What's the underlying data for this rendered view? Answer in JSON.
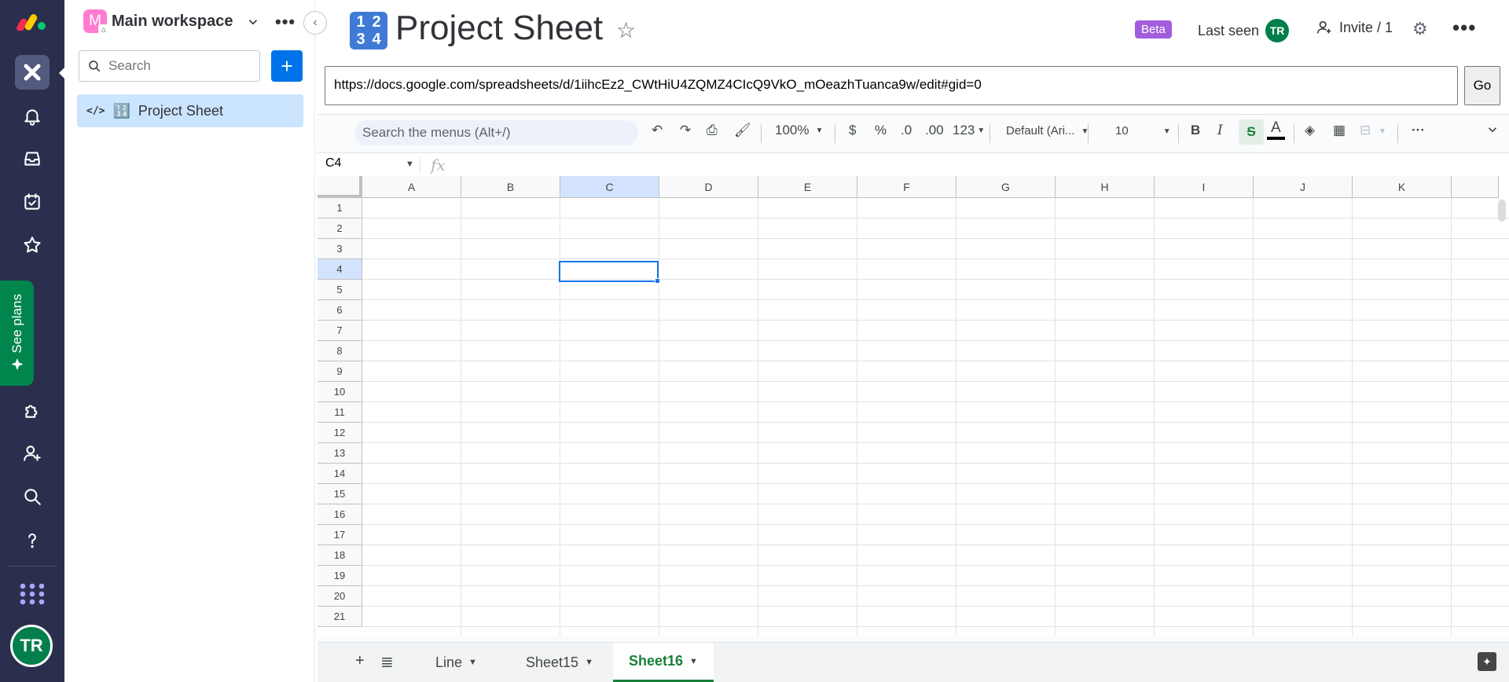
{
  "rail": {
    "see_plans": "See plans",
    "user_initials": "TR"
  },
  "workspace": {
    "avatar_letter": "M",
    "name": "Main workspace",
    "search_placeholder": "Search",
    "add_label": "+",
    "board_emoji": "🔢",
    "board_label": "Project Sheet"
  },
  "header": {
    "title_emoji": [
      "1",
      "2",
      "3",
      "4"
    ],
    "title": "Project Sheet",
    "beta": "Beta",
    "last_seen": "Last seen",
    "last_seen_initials": "TR",
    "invite": "Invite / 1"
  },
  "embed": {
    "url": "https://docs.google.com/spreadsheets/d/1iihcEz2_CWtHiU4ZQMZ4CIcQ9VkO_mOeazhTuanca9w/edit#gid=0",
    "go": "Go"
  },
  "sheet": {
    "search_menus": "Search the menus (Alt+/)",
    "zoom": "100%",
    "currency": "$",
    "percent": "%",
    "dec_decrease": ".0",
    "dec_increase": ".00",
    "number_format": "123",
    "font": "Default (Ari...",
    "font_size": "10",
    "bold": "B",
    "italic": "I",
    "strike": "S",
    "text_color_letter": "A",
    "name_box": "C4",
    "fx": "fx",
    "columns": [
      "A",
      "B",
      "C",
      "D",
      "E",
      "F",
      "G",
      "H",
      "I",
      "J",
      "K"
    ],
    "selected_column": "C",
    "selected_row": "4",
    "rows": [
      "1",
      "2",
      "3",
      "4",
      "5",
      "6",
      "7",
      "8",
      "9",
      "10",
      "11",
      "12",
      "13",
      "14",
      "15",
      "16",
      "17",
      "18",
      "19",
      "20",
      "21"
    ],
    "tabs": [
      "Line",
      "Sheet15",
      "Sheet16"
    ],
    "active_tab": "Sheet16"
  },
  "colors": {
    "rail_bg": "#292f4c",
    "primary": "#0073ea",
    "sheets_green": "#188038",
    "beta": "#a25ddc",
    "selection": "#1a73e8"
  }
}
